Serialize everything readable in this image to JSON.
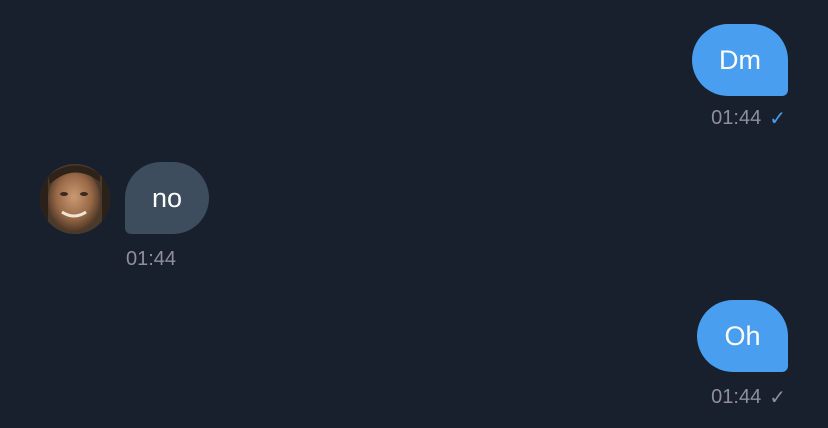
{
  "colors": {
    "background": "#19202d",
    "outgoing_bubble": "#4a9ef0",
    "incoming_bubble": "#3e4d5e",
    "timestamp": "#8a919c",
    "read_check": "#4a9ef0",
    "sent_check": "#8a919c"
  },
  "messages": [
    {
      "direction": "outgoing",
      "text": "Dm",
      "time": "01:44",
      "status_icon": "✓",
      "status": "read"
    },
    {
      "direction": "incoming",
      "text": "no",
      "time": "01:44",
      "avatar_icon": "contact-avatar"
    },
    {
      "direction": "outgoing",
      "text": "Oh",
      "time": "01:44",
      "status_icon": "✓",
      "status": "sent"
    }
  ]
}
